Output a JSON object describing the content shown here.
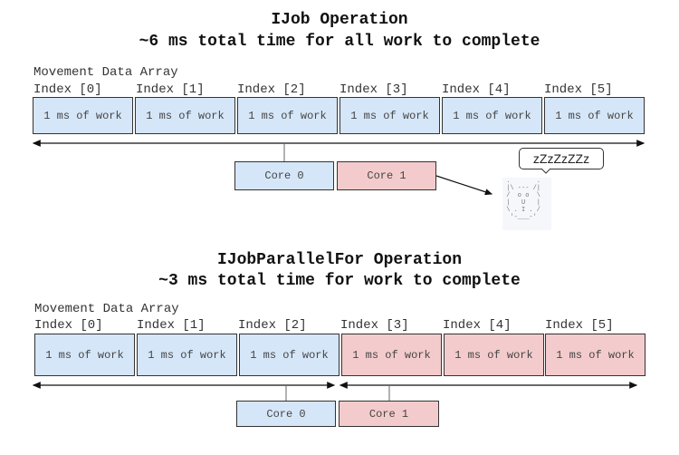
{
  "top": {
    "title": "IJob Operation",
    "subtitle": "~6 ms total time for all work to complete",
    "array_label": "Movement Data Array",
    "indices": [
      "Index [0]",
      "Index [1]",
      "Index [2]",
      "Index [3]",
      "Index [4]",
      "Index [5]"
    ],
    "cells": [
      "1 ms of work",
      "1 ms of work",
      "1 ms of work",
      "1 ms of work",
      "1 ms of work",
      "1 ms of work"
    ],
    "cores": [
      "Core 0",
      "Core 1"
    ],
    "sleep_text": "zZzZzZZz",
    "owl_ascii": " .       .\n |\\ --- /|\n /  o o  \\\n |   U   |\n \\ . I . /\n  '-___-'"
  },
  "bottom": {
    "title": "IJobParallelFor Operation",
    "subtitle": "~3 ms total time for work to complete",
    "array_label": "Movement Data Array",
    "indices": [
      "Index [0]",
      "Index [1]",
      "Index [2]",
      "Index [3]",
      "Index [4]",
      "Index [5]"
    ],
    "cells": [
      "1 ms of work",
      "1 ms of work",
      "1 ms of work",
      "1 ms of work",
      "1 ms of work",
      "1 ms of work"
    ],
    "cores": [
      "Core 0",
      "Core 1"
    ]
  },
  "colors": {
    "core0": "#d5e6f8",
    "core1": "#f3cbcc"
  }
}
